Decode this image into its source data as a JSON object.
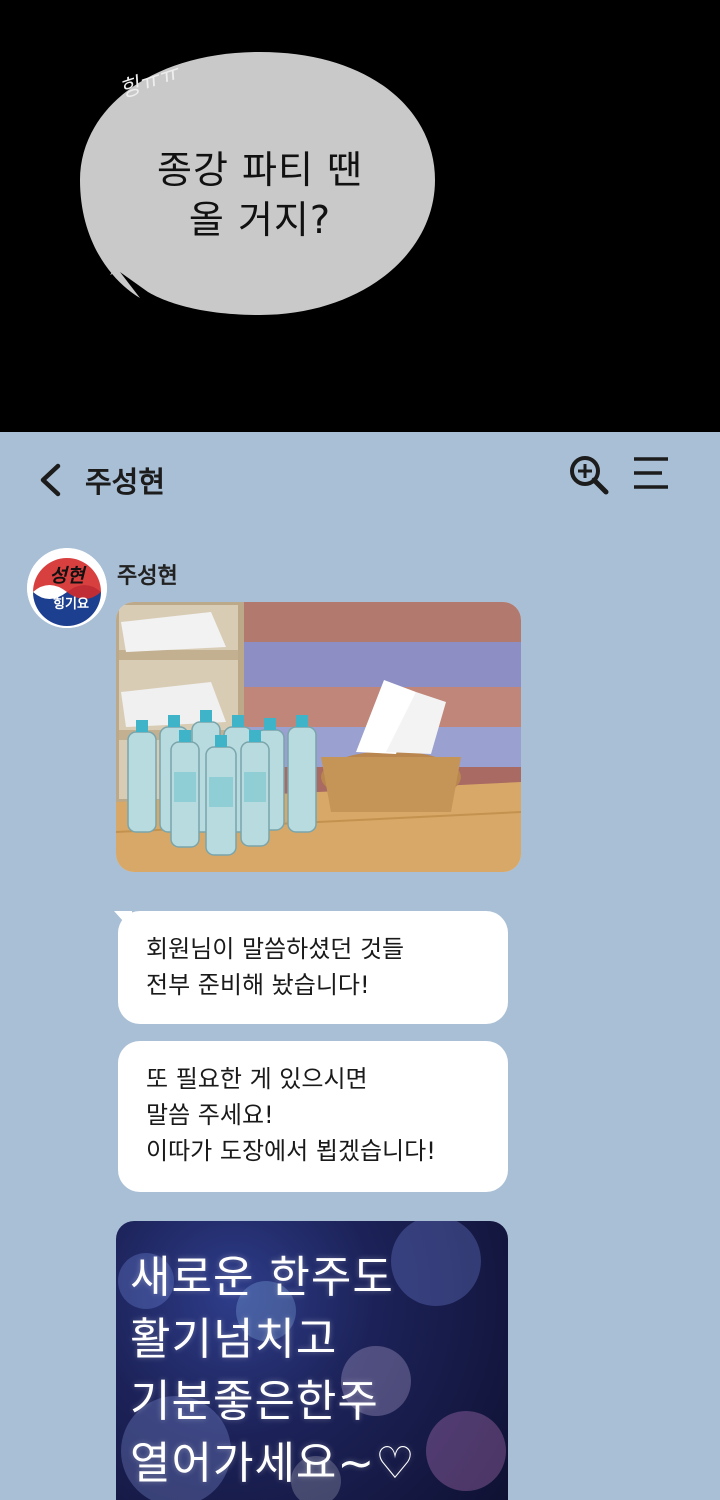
{
  "comic": {
    "sfx": "힝ㅠㅠ",
    "bubble_lines": [
      "종강 파티 땐",
      "올 거지?"
    ]
  },
  "chat": {
    "header_title": "주성현",
    "sender_name": "주성현",
    "avatar_text": [
      "성현",
      "힝기요"
    ],
    "messages": [
      {
        "type": "text",
        "lines": [
          "회원님이 말씀하셨던 것들",
          "전부 준비해 놨습니다!"
        ]
      },
      {
        "type": "text",
        "lines": [
          "또 필요한 게 있으시면",
          "말씀 주세요!",
          "이따가 도장에서 뵙겠습니다!"
        ]
      }
    ],
    "emoticon_lines": [
      "새로운  한주도",
      "활기넘치고",
      "기분좋은한주",
      "열어가세요~♡"
    ]
  },
  "colors": {
    "chat_background": "#a9bfd6",
    "bubble": "#ffffff",
    "comic_background": "#000000"
  },
  "icons": [
    "back-arrow-icon",
    "search-zoom-icon",
    "menu-icon"
  ]
}
